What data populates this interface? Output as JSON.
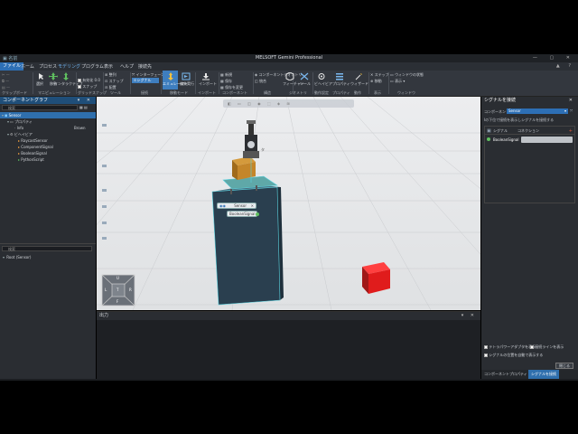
{
  "window": {
    "title": "MELSOFT Gemini Professional",
    "quick_access": "▣ 名前",
    "controls": "— ▢ ✕"
  },
  "menu": {
    "items": [
      "ファイル",
      "ホーム",
      "プロセス",
      "モデリング",
      "プログラム",
      "表示",
      "ヘルプ",
      "接続先"
    ],
    "active_index": 0,
    "selected_index": 3,
    "right_controls": "▲ ?"
  },
  "ribbon": {
    "groups": [
      {
        "label": "クリップボード"
      },
      {
        "label": "マニピュレーション"
      },
      {
        "label": "グリッドスナップ"
      },
      {
        "label": "ツール"
      },
      {
        "label": "接続"
      },
      {
        "label": "移動モード"
      },
      {
        "label": "インポート"
      },
      {
        "label": "コンポーネント"
      },
      {
        "label": "構造"
      },
      {
        "label": "ジオメトリ"
      },
      {
        "label": "動作設定"
      },
      {
        "label": "プロパティ"
      },
      {
        "label": "動作"
      },
      {
        "label": "表示"
      },
      {
        "label": "ウィンドウ"
      }
    ],
    "buttons": {
      "select": "選択",
      "move": "移動",
      "interactive": "インタラクティブ",
      "snap_enabled": "有効化 0.0",
      "snap_x": "スナップ",
      "align": "整列",
      "snap2": "スナップ",
      "place": "配置",
      "interface": "インターフェース",
      "signal": "シグナル",
      "edit_mode": "エミュレーター",
      "model_mode": "編集実行",
      "import": "インポート",
      "new": "新規",
      "save": "保存",
      "save_as": "保存を変更",
      "component_geometry": "コンポーネントジオメトリ",
      "merge": "統合",
      "feature": "フィーチャー",
      "tool": "ツール",
      "behavior": "ビヘイビア",
      "properties": "プロパティ",
      "wizard": "ウィザード",
      "step": "ステップ",
      "move2": "移動",
      "window_state": "ウィンドウの状態",
      "display": "表示"
    },
    "accent": "#2d6fb5"
  },
  "left_panel": {
    "header": "コンポーネントグラフ",
    "search_placeholder": "検索",
    "tree": [
      {
        "label": "Sensor",
        "level": 0,
        "selected": true
      },
      {
        "label": "プロパティ",
        "level": 1
      },
      {
        "label": "Info",
        "level": 2,
        "value": "Brown"
      },
      {
        "label": "ビヘイビア",
        "level": 1
      },
      {
        "label": "RaycastSensor",
        "level": 2
      },
      {
        "label": "ComponentSignal",
        "level": 2
      },
      {
        "label": "BooleanSignal",
        "level": 2
      },
      {
        "label": "PythonScript",
        "level": 2
      }
    ],
    "second_search_placeholder": "検索",
    "second_tree": [
      {
        "label": "Root (Sensor)"
      }
    ]
  },
  "viewport": {
    "toolbar_icons": "◧ ▭ ◫ ◉ ⬚ ◈ ⊞",
    "sensor_label": "Sensor",
    "signal_label": "BooleanSignal",
    "part_label": "タ",
    "nav_cube": {
      "up": "U",
      "left": "L",
      "top": "T",
      "right": "R",
      "front": "F"
    }
  },
  "output_panel": {
    "header": "出力",
    "controls": "▾ ✕"
  },
  "right_panel": {
    "header": "シグナルを接続",
    "component_label": "コンポーネント",
    "component_value": "Sensor",
    "hint": "Iの下位で接続を表示しシグナルを接続する",
    "columns": [
      "シグナル",
      "コネクション"
    ],
    "rows": [
      {
        "signal": "BooleanSignal",
        "connection": ""
      }
    ],
    "options": [
      {
        "label": "テトラパワーアダプタを表示",
        "checked": true
      },
      {
        "label": "接続ラインを表示",
        "checked": true
      },
      {
        "label": "シグナルの位置を自動で表示する",
        "checked": true
      }
    ],
    "close_button": "閉じる"
  },
  "bottom_tabs": [
    "コンポーネントプロパティ",
    "シグナルを接続"
  ],
  "bottom_active": 1
}
